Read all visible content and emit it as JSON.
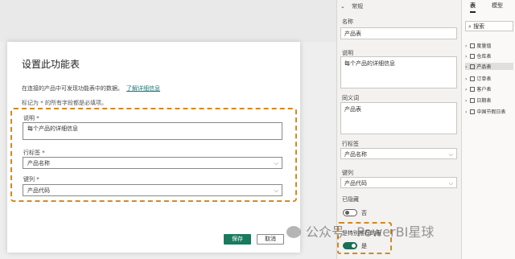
{
  "dialog": {
    "title": "设置此功能表",
    "description": "在连接的产品中可发现功能表中的数据。",
    "learn_more": "了解详细信息",
    "required_note": "标记为 * 的所有字段都是必填项。",
    "description_label": "说明 *",
    "description_value": "每个产品的详细信息",
    "row_label_label": "行标签 *",
    "row_label_value": "产品名称",
    "key_column_label": "键列 *",
    "key_column_value": "产品代码",
    "save_label": "保存",
    "cancel_label": "取消"
  },
  "properties": {
    "section": "常规",
    "name_label": "名称",
    "name_value": "产品表",
    "desc_label": "说明",
    "desc_value": "每个产品的详细信息",
    "synonyms_label": "同义词",
    "synonyms_value": "产品表",
    "row_label_label": "行标签",
    "row_label_value": "产品名称",
    "key_column_label": "键列",
    "key_column_value": "产品代码",
    "hidden_label": "已隐藏",
    "hidden_value": "否",
    "featured_label": "是特别推荐的表",
    "featured_value": "是"
  },
  "data_pane": {
    "tabs": [
      "表",
      "模型"
    ],
    "search_placeholder": "搜索",
    "tables": [
      "度量值",
      "仓库表",
      "产品表",
      "订单表",
      "客户表",
      "日期表",
      "中国节假日表"
    ]
  },
  "watermark": "公众号 · PowerBI星球",
  "colors": {
    "accent": "#1a7a5e",
    "highlight": "#d4891e"
  }
}
